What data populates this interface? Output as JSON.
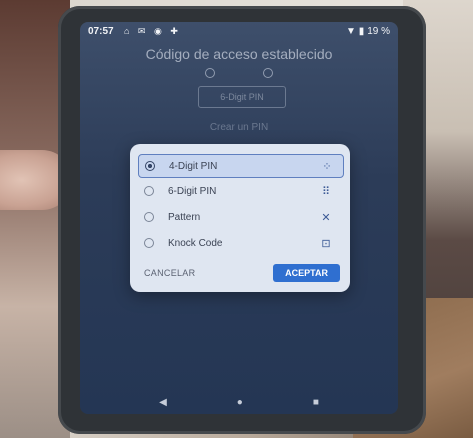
{
  "status": {
    "time": "07:57",
    "battery": "19 %",
    "left_icons": "⌂ ✉ ◉ ✚",
    "right_icons": "▼ ▮"
  },
  "background_screen": {
    "title": "Código de acceso establecido",
    "chip_label": "6-Digit PIN",
    "link": "Crear un PIN"
  },
  "dialog": {
    "options": [
      {
        "label": "4-Digit PIN",
        "icon": "grid-4-icon",
        "glyph": "⁘",
        "selected": true
      },
      {
        "label": "6-Digit PIN",
        "icon": "grid-6-icon",
        "glyph": "⠿",
        "selected": false
      },
      {
        "label": "Pattern",
        "icon": "pattern-icon",
        "glyph": "✕",
        "selected": false
      },
      {
        "label": "Knock Code",
        "icon": "knock-code-icon",
        "glyph": "⊡",
        "selected": false
      }
    ],
    "cancel_label": "CANCELAR",
    "accept_label": "ACEPTAR"
  },
  "nav": {
    "back": "◀",
    "home": "●",
    "recents": "■"
  },
  "colors": {
    "accent": "#2f6fd0",
    "dialog_bg": "#dfe6f1",
    "screen_bg": "#2c3c58"
  }
}
